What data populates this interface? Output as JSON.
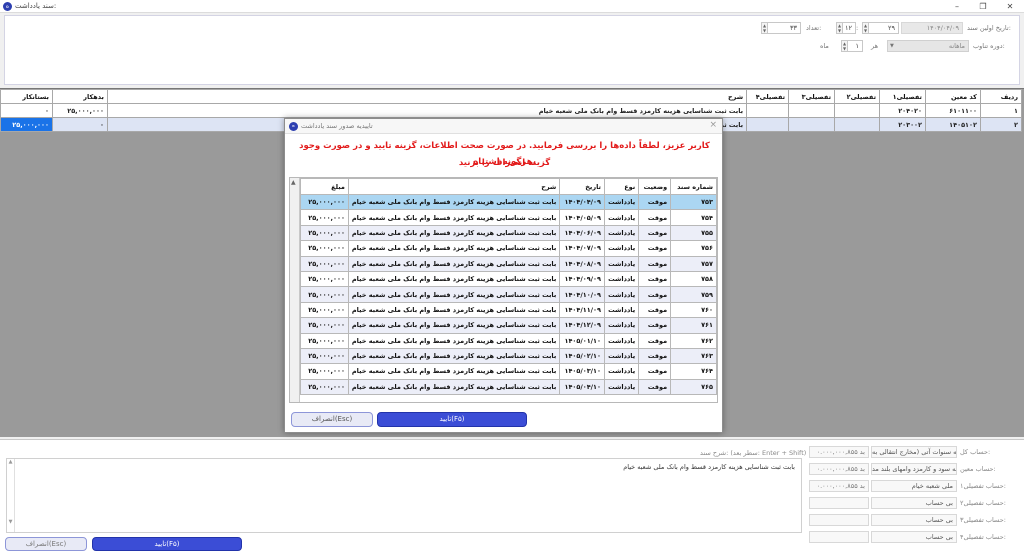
{
  "window": {
    "title": "سند یادداشت:"
  },
  "filter": {
    "first_date_label": "تاریخ اولین سند:",
    "first_date_value": "۱۴۰۴/۰۴/۰۹",
    "day_value": "۲۹",
    "month_value": "۱۲",
    "count_label": "تعداد:",
    "count_value": "۳۳",
    "period_label": "دوره تناوب:",
    "period_value": "ماهانه",
    "every_label": "هر",
    "every_value": "۱",
    "month_unit": "ماه"
  },
  "main_grid": {
    "columns": [
      "ردیف",
      "کد معین",
      "تفصیلی۱",
      "تفصیلی۲",
      "تفصیلی۳",
      "تفصیلی۴",
      "شرح",
      "بدهکار",
      "بستانکار"
    ],
    "rows": [
      {
        "row": "۱",
        "code": "۶۱۰۱۱۰۰",
        "t1": "۲۰۴۰۲۰",
        "t2": "",
        "t3": "",
        "t4": "",
        "desc": "بابت ثبت شناسایی هزینه کارمزد قسط وام بانک ملی شعبه خیام",
        "debit": "۲۵,۰۰۰,۰۰۰",
        "credit": "۰"
      },
      {
        "row": "۲",
        "code": "۱۴۰۵۱۰۲",
        "t1": "۲۰۳۰۰۲",
        "t2": "",
        "t3": "",
        "t4": "",
        "desc": "بابت ثبت",
        "debit": "۰",
        "credit": "۲۵,۰۰۰,۰۰۰"
      }
    ]
  },
  "modal": {
    "title": "تاییدیه صدور سند یادداشت",
    "warning_line1": "کاربر عزیز، لطفاً داده‌ها را بررسی فرمایید. در صورت صحت اطلاعات، گزینه تایید و در صورت وجود هرگونه اشتباه،",
    "warning_line2": "گزینه انصراف را بزنید",
    "columns": [
      "شماره سند",
      "وضعیت",
      "نوع",
      "تاریخ",
      "شرح",
      "مبلغ"
    ],
    "rows": [
      {
        "num": "۷۵۳",
        "status": "موقت",
        "type": "یادداشت",
        "date": "۱۴۰۴/۰۴/۰۹",
        "desc": "بابت ثبت شناسایی هزینه کارمزد قسط وام بانک ملی شعبه خیام",
        "amount": "۲۵,۰۰۰,۰۰۰"
      },
      {
        "num": "۷۵۴",
        "status": "موقت",
        "type": "یادداشت",
        "date": "۱۴۰۴/۰۵/۰۹",
        "desc": "بابت ثبت شناسایی هزینه کارمزد قسط وام بانک ملی شعبه خیام",
        "amount": "۲۵,۰۰۰,۰۰۰"
      },
      {
        "num": "۷۵۵",
        "status": "موقت",
        "type": "یادداشت",
        "date": "۱۴۰۴/۰۶/۰۹",
        "desc": "بابت ثبت شناسایی هزینه کارمزد قسط وام بانک ملی شعبه خیام",
        "amount": "۲۵,۰۰۰,۰۰۰"
      },
      {
        "num": "۷۵۶",
        "status": "موقت",
        "type": "یادداشت",
        "date": "۱۴۰۴/۰۷/۰۹",
        "desc": "بابت ثبت شناسایی هزینه کارمزد قسط وام بانک ملی شعبه خیام",
        "amount": "۲۵,۰۰۰,۰۰۰"
      },
      {
        "num": "۷۵۷",
        "status": "موقت",
        "type": "یادداشت",
        "date": "۱۴۰۴/۰۸/۰۹",
        "desc": "بابت ثبت شناسایی هزینه کارمزد قسط وام بانک ملی شعبه خیام",
        "amount": "۲۵,۰۰۰,۰۰۰"
      },
      {
        "num": "۷۵۸",
        "status": "موقت",
        "type": "یادداشت",
        "date": "۱۴۰۴/۰۹/۰۹",
        "desc": "بابت ثبت شناسایی هزینه کارمزد قسط وام بانک ملی شعبه خیام",
        "amount": "۲۵,۰۰۰,۰۰۰"
      },
      {
        "num": "۷۵۹",
        "status": "موقت",
        "type": "یادداشت",
        "date": "۱۴۰۴/۱۰/۰۹",
        "desc": "بابت ثبت شناسایی هزینه کارمزد قسط وام بانک ملی شعبه خیام",
        "amount": "۲۵,۰۰۰,۰۰۰"
      },
      {
        "num": "۷۶۰",
        "status": "موقت",
        "type": "یادداشت",
        "date": "۱۴۰۴/۱۱/۰۹",
        "desc": "بابت ثبت شناسایی هزینه کارمزد قسط وام بانک ملی شعبه خیام",
        "amount": "۲۵,۰۰۰,۰۰۰"
      },
      {
        "num": "۷۶۱",
        "status": "موقت",
        "type": "یادداشت",
        "date": "۱۴۰۴/۱۲/۰۹",
        "desc": "بابت ثبت شناسایی هزینه کارمزد قسط وام بانک ملی شعبه خیام",
        "amount": "۲۵,۰۰۰,۰۰۰"
      },
      {
        "num": "۷۶۲",
        "status": "موقت",
        "type": "یادداشت",
        "date": "۱۴۰۵/۰۱/۱۰",
        "desc": "بابت ثبت شناسایی هزینه کارمزد قسط وام بانک ملی شعبه خیام",
        "amount": "۲۵,۰۰۰,۰۰۰"
      },
      {
        "num": "۷۶۳",
        "status": "موقت",
        "type": "یادداشت",
        "date": "۱۴۰۵/۰۲/۱۰",
        "desc": "بابت ثبت شناسایی هزینه کارمزد قسط وام بانک ملی شعبه خیام",
        "amount": "۲۵,۰۰۰,۰۰۰"
      },
      {
        "num": "۷۶۴",
        "status": "موقت",
        "type": "یادداشت",
        "date": "۱۴۰۵/۰۳/۱۰",
        "desc": "بابت ثبت شناسایی هزینه کارمزد قسط وام بانک ملی شعبه خیام",
        "amount": "۲۵,۰۰۰,۰۰۰"
      },
      {
        "num": "۷۶۵",
        "status": "موقت",
        "type": "یادداشت",
        "date": "۱۴۰۵/۰۴/۱۰",
        "desc": "بابت ثبت شناسایی هزینه کارمزد قسط وام بانک ملی شعبه خیام",
        "amount": "۲۵,۰۰۰,۰۰۰"
      }
    ],
    "ok_label": "تایید(F۵)",
    "cancel_label": "انصراف(Esc)"
  },
  "bottom": {
    "notes_label": "شرح سند: (سطر بعد: Enter + Shift)",
    "notes_text": "بابت ثبت شناسایی هزینه کارمزد قسط وام بانک ملی شعبه خیام",
    "accounts": [
      {
        "label": "حساب کل:",
        "name": "هزینه سنوات آتی (مخارج انتقالی به",
        "value": "۰.۰۰۰,۰۰۰,۸۵۵ بد"
      },
      {
        "label": "حساب معین:",
        "name": "هزینه سود و کارمزد وامهای بلند مد",
        "value": "۰.۰۰۰,۰۰۰,۸۵۵ بد"
      },
      {
        "label": "حساب تفصیلی۱:",
        "name": "ملی شعبه خیام",
        "value": "۰.۰۰۰,۰۰۰,۸۵۵ بد"
      },
      {
        "label": "حساب تفصیلی۲:",
        "name": "بی حساب",
        "value": ""
      },
      {
        "label": "حساب تفصیلی۳:",
        "name": "بی حساب",
        "value": ""
      },
      {
        "label": "حساب تفصیلی۴:",
        "name": "بی حساب",
        "value": ""
      }
    ],
    "ok_label": "تایید(F۵)",
    "cancel_label": "انصراف(Esc)"
  }
}
